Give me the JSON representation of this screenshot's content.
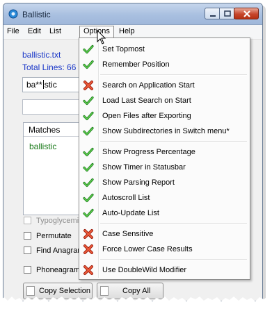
{
  "window": {
    "title": "Ballistic"
  },
  "menubar": {
    "items": [
      "File",
      "Edit",
      "List",
      "Options",
      "Help"
    ]
  },
  "main": {
    "filename": "ballistic.txt",
    "total_lines": "Total Lines: 66",
    "search_value_before": "ba**",
    "search_value_after": "stic",
    "matches_header": "Matches",
    "matches": [
      "ballistic"
    ],
    "checkboxes": [
      {
        "label": "Typoglycemize",
        "checked": false,
        "disabled": true
      },
      {
        "label": "Permutate",
        "checked": false,
        "disabled": false
      },
      {
        "label": "Find Anagrams",
        "checked": false,
        "disabled": false
      },
      {
        "label": "Phoneagrams",
        "checked": false,
        "disabled": false
      }
    ],
    "buttons": {
      "copy_selection": "Copy Selection",
      "copy_all": "Copy All"
    }
  },
  "options_menu": {
    "groups": [
      [
        {
          "label": "Set Topmost",
          "state": "checked"
        },
        {
          "label": "Remember Position",
          "state": "checked"
        }
      ],
      [
        {
          "label": "Search on Application Start",
          "state": "unchecked"
        },
        {
          "label": "Load Last Search on Start",
          "state": "checked"
        },
        {
          "label": "Open Files after Exporting",
          "state": "checked"
        },
        {
          "label": "Show Subdirectories in Switch menu*",
          "state": "checked"
        }
      ],
      [
        {
          "label": "Show Progress Percentage",
          "state": "checked"
        },
        {
          "label": "Show Timer in Statusbar",
          "state": "checked"
        },
        {
          "label": "Show Parsing Report",
          "state": "checked"
        },
        {
          "label": "Autoscroll List",
          "state": "checked"
        },
        {
          "label": "Auto-Update List",
          "state": "checked"
        }
      ],
      [
        {
          "label": "Case Sensitive",
          "state": "unchecked"
        },
        {
          "label": "Force Lower Case Results",
          "state": "unchecked"
        }
      ],
      [
        {
          "label": "Use DoubleWild Modifier",
          "state": "unchecked"
        }
      ]
    ]
  },
  "colors": {
    "link_blue": "#1a37c8",
    "match_green": "#1a7a1a",
    "check_green": "#3aa83a",
    "cross_red": "#d8402a"
  },
  "icons": {
    "checked": "green-check-icon",
    "unchecked": "red-x-icon",
    "app": "ballistic-app-icon"
  }
}
